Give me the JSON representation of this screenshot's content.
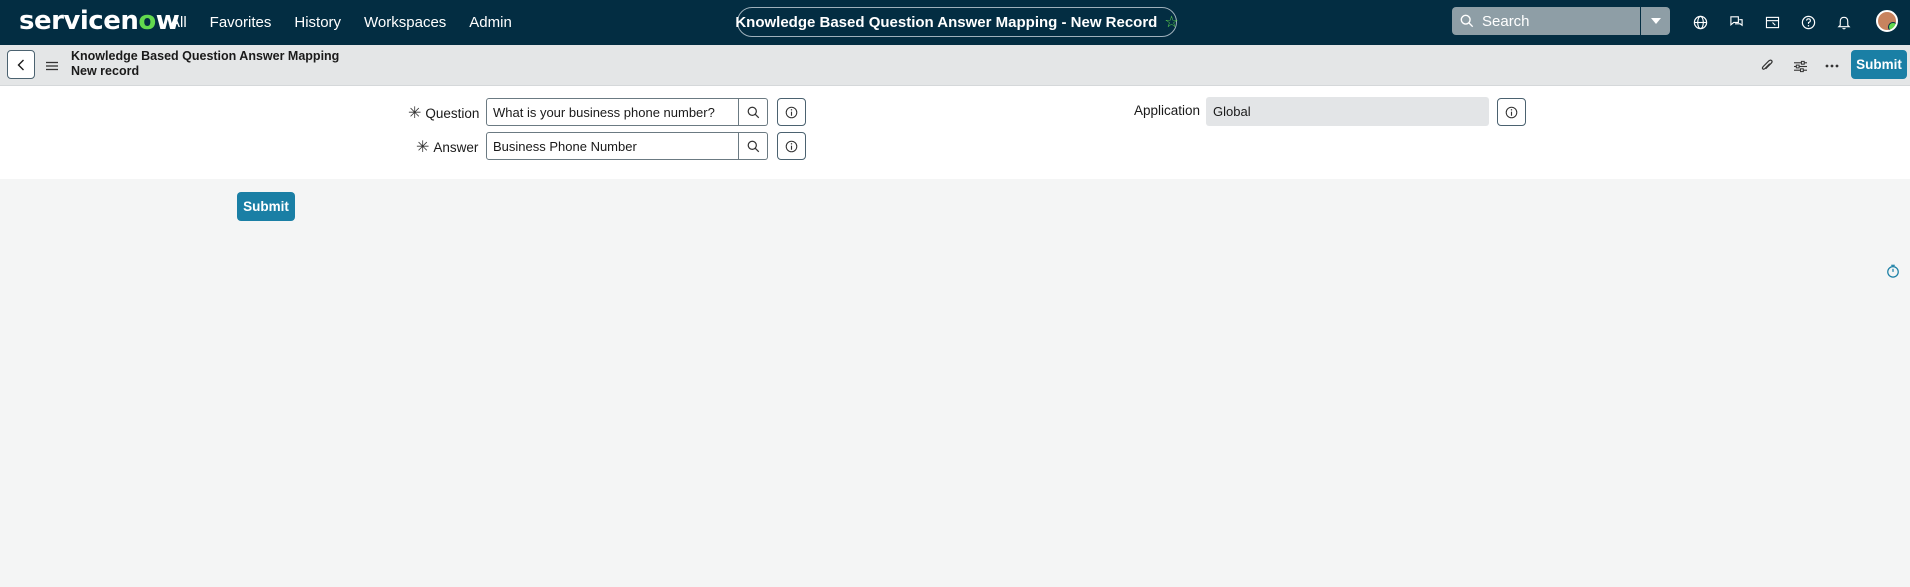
{
  "topnav": {
    "logo_text_a": "servicen",
    "logo_text_o": "o",
    "logo_text_b": "w",
    "menu": [
      "All",
      "Favorites",
      "History",
      "Workspaces",
      "Admin"
    ],
    "page_title": "Knowledge Based Question Answer Mapping - New Record",
    "search_placeholder": "Search",
    "icons": [
      "globe-icon",
      "chat-icon",
      "inbox-icon",
      "help-icon",
      "bell-icon",
      "avatar"
    ]
  },
  "record_header": {
    "table_name": "Knowledge Based Question Answer Mapping",
    "record_state": "New record",
    "submit_label": "Submit"
  },
  "form": {
    "question_label": "Question",
    "question_value": "What is your business phone number?",
    "answer_label": "Answer",
    "answer_value": "Business Phone Number",
    "application_label": "Application",
    "application_value": "Global"
  },
  "footer": {
    "submit_label": "Submit"
  },
  "colors": {
    "nav_bg": "#032d42",
    "accent": "#1a7fa5",
    "brand_green": "#62d84e"
  }
}
